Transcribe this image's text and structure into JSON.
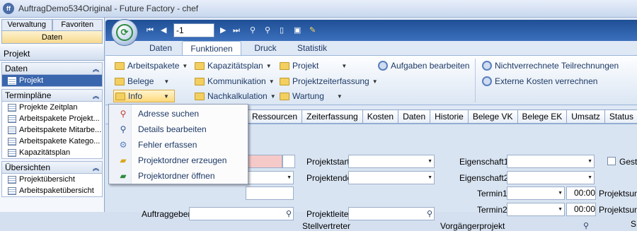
{
  "window": {
    "title": "AuftragDemo534Original - Future Factory - chef",
    "app_icon": "ff"
  },
  "left": {
    "tabs": [
      "Verwaltung",
      "Favoriten"
    ],
    "selected_tab": "Daten",
    "section": "Projekt",
    "groups": [
      {
        "title": "Daten",
        "items": [
          "Projekt"
        ]
      },
      {
        "title": "Terminpläne",
        "items": [
          "Projekte Zeitplan",
          "Arbeitspakete Projekt...",
          "Arbeitspakete Mitarbe...",
          "Arbeitspakete Katego...",
          "Kapazitätsplan"
        ]
      },
      {
        "title": "Übersichten",
        "items": [
          "Projektübersicht",
          "Arbeitspaketübersicht"
        ]
      }
    ]
  },
  "toolbar": {
    "record": "-1"
  },
  "ribbon_tabs": [
    "Daten",
    "Funktionen",
    "Druck",
    "Statistik"
  ],
  "ribbon": {
    "arbeitspakete": "Arbeitspakete",
    "belege": "Belege",
    "info": "Info",
    "kapazitaetsplan": "Kapazitätsplan",
    "kommunikation": "Kommunikation",
    "nachkalkulation": "Nachkalkulation",
    "projekt": "Projekt",
    "projektzeiterfassung": "Projektzeiterfassung",
    "wartung": "Wartung",
    "aufgaben": "Aufgaben bearbeiten",
    "nichtverrechnete": "Nichtverrechnete Teilrechnungen",
    "externe": "Externe Kosten verrechnen"
  },
  "subtabs": [
    "Ressourcen",
    "Zeiterfassung",
    "Kosten",
    "Daten",
    "Historie",
    "Belege VK",
    "Belege EK",
    "Umsatz",
    "Status"
  ],
  "form": {
    "projektstart": "Projektstart",
    "projektende": "Projektende",
    "auftraggeber": "Auftraggeber",
    "projektleiter": "Projektleiter",
    "stellvertreter": "Stellvertreter",
    "eigenschaft1": "Eigenschaft1",
    "eigenschaft2": "Eigenschaft2",
    "termin1": "Termin1",
    "termin2": "Termin2",
    "vorgaenger": "Vorgängerprojekt",
    "zeit1": "00:00",
    "zeit2": "00:00",
    "projektsum1": "Projektsum",
    "projektsum2": "Projektsumm",
    "gesta": "Gesta",
    "s": "S"
  },
  "menu": {
    "items": [
      "Adresse suchen",
      "Details bearbeiten",
      "Fehler erfassen",
      "Projektordner erzeugen",
      "Projektordner öffnen"
    ]
  }
}
